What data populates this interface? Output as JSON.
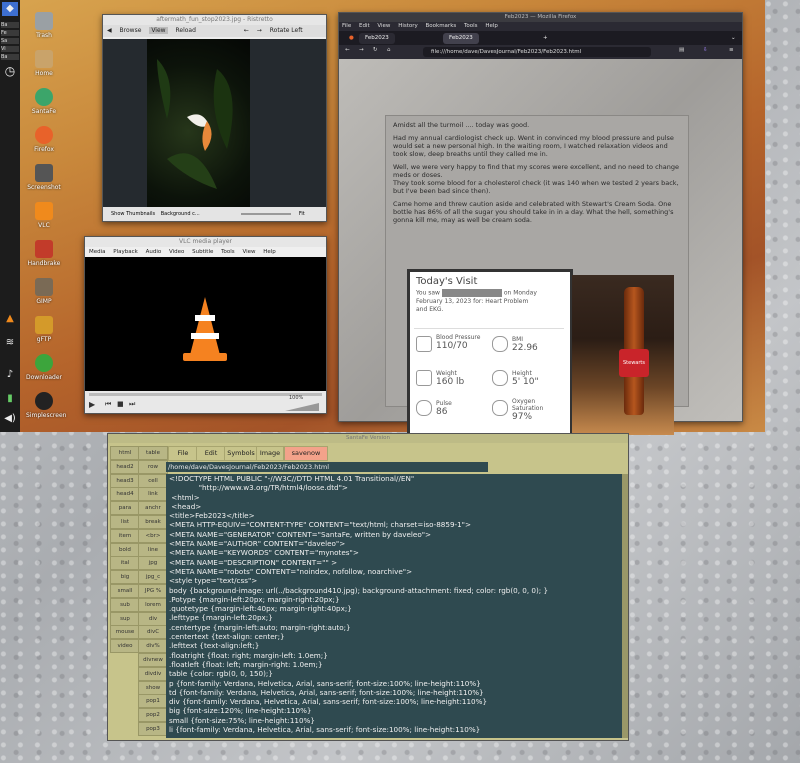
{
  "desktop_icons": [
    "Trash",
    "Home",
    "SantaFe",
    "Firefox",
    "Screenshot",
    "VLC",
    "Handbrake",
    "GIMP",
    "gFTP",
    "Downloader",
    "Simplescreen"
  ],
  "panel": {
    "tasks": [
      "Ba",
      "Fe",
      "Sa",
      "Vi",
      "Ba"
    ]
  },
  "image_viewer": {
    "title": "aftermath_fun_stop2023.jpg - Ristretto",
    "toolbar": [
      "Browse",
      "View",
      "Reload",
      "Rotate Left"
    ],
    "status": {
      "thumbs": "Show Thumbnails",
      "bg": "Background c...",
      "zoom": "Fit"
    }
  },
  "vlc": {
    "title": "VLC media player",
    "menu": [
      "Media",
      "Playback",
      "Audio",
      "Video",
      "Subtitle",
      "Tools",
      "View",
      "Help"
    ],
    "volume": "100%"
  },
  "firefox": {
    "title": "Feb2023 — Mozilla Firefox",
    "menu": [
      "File",
      "Edit",
      "View",
      "History",
      "Bookmarks",
      "Tools",
      "Help"
    ],
    "tabs": [
      "Feb2023",
      "Feb2023"
    ],
    "url": "file:///home/dave/DavesJournal/Feb2023/Feb2023.html",
    "paragraphs": [
      "Amidst all the turmoil .... today was good.",
      "Had my annual cardiologist check up. Went in convinced my blood pressure and pulse would set a new personal high. In the waiting room, I watched relaxation videos and took slow, deep breaths until they called me in.",
      "Well, we were very happy to find that my scores were excellent, and no need to change meds or doses.",
      "They took some blood for a cholesterol check (it was 140 when we tested 2 years back, but I've been bad since then).",
      "Came home and threw caution aside and celebrated with Stewart's Cream Soda. One bottle has 86% of all the sugar you should take in in a day. What the hell, something's gonna kill me, may as well be cream soda."
    ],
    "visit": {
      "title": "Today's Visit",
      "you_saw": "You saw",
      "date_line": "on Monday",
      "date_line2": "February 13, 2023 for: Heart Problem",
      "date_line3": "and EKG.",
      "metrics": [
        {
          "label": "Blood Pressure",
          "value": "110/70"
        },
        {
          "label": "BMI",
          "value": "22.96"
        },
        {
          "label": "Weight",
          "value": "160 lb"
        },
        {
          "label": "Height",
          "value": "5' 10\""
        },
        {
          "label": "Pulse",
          "value": "86"
        },
        {
          "label": "Oxygen Saturation",
          "value": "97%"
        }
      ]
    },
    "soda_label": "Stewarts"
  },
  "editor": {
    "title": "SantaFe Version",
    "menu": [
      "File",
      "Edit",
      "Symbols",
      "Image",
      "savenow"
    ],
    "path": "/home/dave/DavesJournal/Feb2023/Feb2023.html",
    "side_buttons": [
      [
        "html",
        "table"
      ],
      [
        "head2",
        "row"
      ],
      [
        "head3",
        "cell"
      ],
      [
        "head4",
        "link"
      ],
      [
        "para",
        "anchr"
      ],
      [
        "list",
        "break"
      ],
      [
        "item",
        "<br>"
      ],
      [
        "bold",
        "line"
      ],
      [
        "ital",
        "jpg"
      ],
      [
        "big",
        "jpg_c"
      ],
      [
        "small",
        "JPG %"
      ],
      [
        "sub",
        "lorem"
      ],
      [
        "sup",
        "div"
      ],
      [
        "mouse",
        "divC"
      ],
      [
        "video",
        "div%"
      ],
      [
        "",
        "divnew"
      ],
      [
        "",
        "divdiv"
      ],
      [
        "",
        "show"
      ],
      [
        "",
        "pop1"
      ],
      [
        "",
        "pop2"
      ],
      [
        "",
        "pop3"
      ]
    ],
    "code_lines": [
      "<!DOCTYPE HTML PUBLIC \"-//W3C//DTD HTML 4.01 Transitional//EN\"",
      "             \"http://www.w3.org/TR/html4/loose.dtd\">",
      " <html>",
      " <head>",
      "<title>Feb2023</title>",
      "<META HTTP-EQUIV=\"CONTENT-TYPE\" CONTENT=\"text/html; charset=iso-8859-1\">",
      "<META NAME=\"GENERATOR\" CONTENT=\"SantaFe, written by daveleo\">",
      "<META NAME=\"AUTHOR\" CONTENT=\"daveleo\">",
      "<META NAME=\"KEYWORDS\" CONTENT=\"mynotes\">",
      "<META NAME=\"DESCRIPTION\" CONTENT=\"\" >",
      "<META NAME=\"robots\" CONTENT=\"noindex, nofollow, noarchive\">",
      "<style type=\"text/css\">",
      "body {background-image: url(../background410.jpg); background-attachment: fixed; color: rgb(0, 0, 0); }",
      ".Potype {margin-left:20px; margin-right:20px;}",
      ".quotetype {margin-left:40px; margin-right:40px;}",
      ".lefttype {margin-left:20px;}",
      ".centertype {margin-left:auto; margin-right:auto;}",
      ".centertext {text-align: center;}",
      ".lefttext {text-align:left;}",
      ".floatright {float: right; margin-left: 1.0em;}",
      ".floatleft {float: left; margin-right: 1.0em;}",
      "table {color: rgb(0, 0, 150);}",
      "p {font-family: Verdana, Helvetica, Arial, sans-serif; font-size:100%; line-height:110%}",
      "td {font-family: Verdana, Helvetica, Arial, sans-serif; font-size:100%; line-height:110%}",
      "div {font-family: Verdana, Helvetica, Arial, sans-serif; font-size:100%; line-height:110%}",
      "big {font-size:120%; line-height:110%}",
      "small {font-size:75%; line-height:110%}",
      "li {font-family: Verdana, Helvetica, Arial, sans-serif; font-size:100%; line-height:110%}"
    ]
  }
}
